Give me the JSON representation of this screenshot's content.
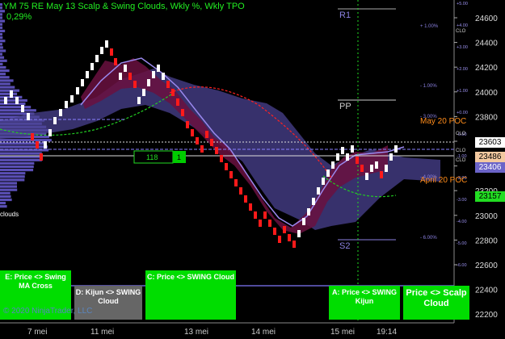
{
  "header": {
    "title": "YM 75 RE May 13 Scalp & Swing Clouds, Wkly %, Wkly TPO",
    "change": "0,29%"
  },
  "price_axis": {
    "ticks": [
      "24600",
      "24400",
      "24200",
      "24000",
      "23800",
      "23600",
      "23400",
      "23200",
      "23000",
      "22800",
      "22600",
      "22400",
      "22200"
    ]
  },
  "time_axis": {
    "labels": [
      "7 mei",
      "11 mei",
      "13 mei",
      "14 mei",
      "15 mei",
      "19:14"
    ]
  },
  "price_markers": [
    {
      "label": "23603",
      "bg": "#ffffff",
      "fg": "#000000"
    },
    {
      "label": "23486",
      "bg": "#f3c9a0",
      "fg": "#000000"
    },
    {
      "label": "23406",
      "bg": "#6b64c8",
      "fg": "#ffffff"
    },
    {
      "label": "23157",
      "bg": "#22dd22",
      "fg": "#000000"
    }
  ],
  "levels": {
    "r1": "R1",
    "pp": "PP",
    "s2": "S2",
    "may_poc": "May 20 POC",
    "april_poc": "April 20 POC",
    "clouds": "clouds"
  },
  "pct_levels": [
    "+ 1.00%",
    "- 1.00%",
    "- 3.00%",
    "- 4.00%",
    "- 6.00%"
  ],
  "axis_small": [
    "+5.00",
    "+4.00",
    "+3.00",
    "+2.00",
    "+1.00",
    "+0.00",
    "-0.50",
    "-1.00",
    "-2.00",
    "-3.00",
    "-4.00",
    "-5.00",
    "-6.00"
  ],
  "cloud_tags": [
    "CLO",
    "CLO",
    "CLO",
    "CLO"
  ],
  "counter": {
    "value": "118",
    "marker": "1"
  },
  "signal_boxes": {
    "e": "E: Price <> Swing MA Cross",
    "d": "D: Kijun <> SWING Cloud",
    "c": "C: Price <> SWING Cloud",
    "a": "A: Price <> SWING Kijun",
    "scalp": "Price <> Scalp Cloud"
  },
  "copyright": "© 2020 NinjaTrader, LLC",
  "colors": {
    "green_signal": "#00dd00",
    "grey_signal": "#666666",
    "cloud_purple": "#5a4fa0",
    "cloud_maroon": "#6a1040",
    "bull_bar": "#ffffff",
    "bear_bar": "#ff0000"
  }
}
